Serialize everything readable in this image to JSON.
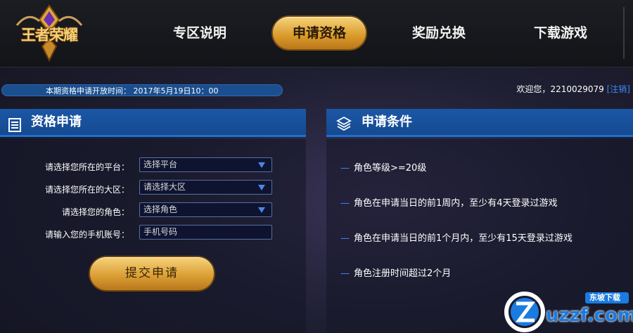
{
  "logo": {
    "text": "王者荣耀"
  },
  "nav": {
    "items": [
      {
        "label": "专区说明"
      },
      {
        "label": "申请资格"
      },
      {
        "label": "奖励兑换"
      },
      {
        "label": "下载游戏"
      }
    ],
    "active_index": 1
  },
  "notice": {
    "text": "本期资格申请开放时间： 2017年5月19日10：00"
  },
  "welcome": {
    "prefix": "欢迎您，",
    "user": "2210029079",
    "logout": "[注销]"
  },
  "apply_panel": {
    "title": "资格申请",
    "icon": "list-icon",
    "fields": [
      {
        "label": "请选择您所在的平台：",
        "value": "选择平台",
        "type": "select"
      },
      {
        "label": "请选择您所在的大区：",
        "value": "请选择大区",
        "type": "select"
      },
      {
        "label": "请选择您的角色：",
        "value": "选择角色",
        "type": "select"
      },
      {
        "label": "请输入您的手机账号：",
        "placeholder": "手机号码",
        "type": "input"
      }
    ],
    "submit_label": "提交申请"
  },
  "conditions_panel": {
    "title": "申请条件",
    "icon": "layers-icon",
    "items": [
      {
        "dash": "—",
        "text": "角色等级>=20级"
      },
      {
        "dash": "—",
        "text": "角色在申请当日的前1周内，至少有4天登录过游戏"
      },
      {
        "dash": "—",
        "text": "角色在申请当日的前1个月内，至少有15天登录过游戏"
      },
      {
        "dash": "—",
        "text": "角色注册时间超过2个月"
      }
    ]
  },
  "watermark": {
    "brand": "uzzf.com",
    "tag": "东坡下载"
  },
  "colors": {
    "accent_blue": "#1b57a6",
    "gold": "#dca036",
    "link_blue": "#3d8bff"
  }
}
